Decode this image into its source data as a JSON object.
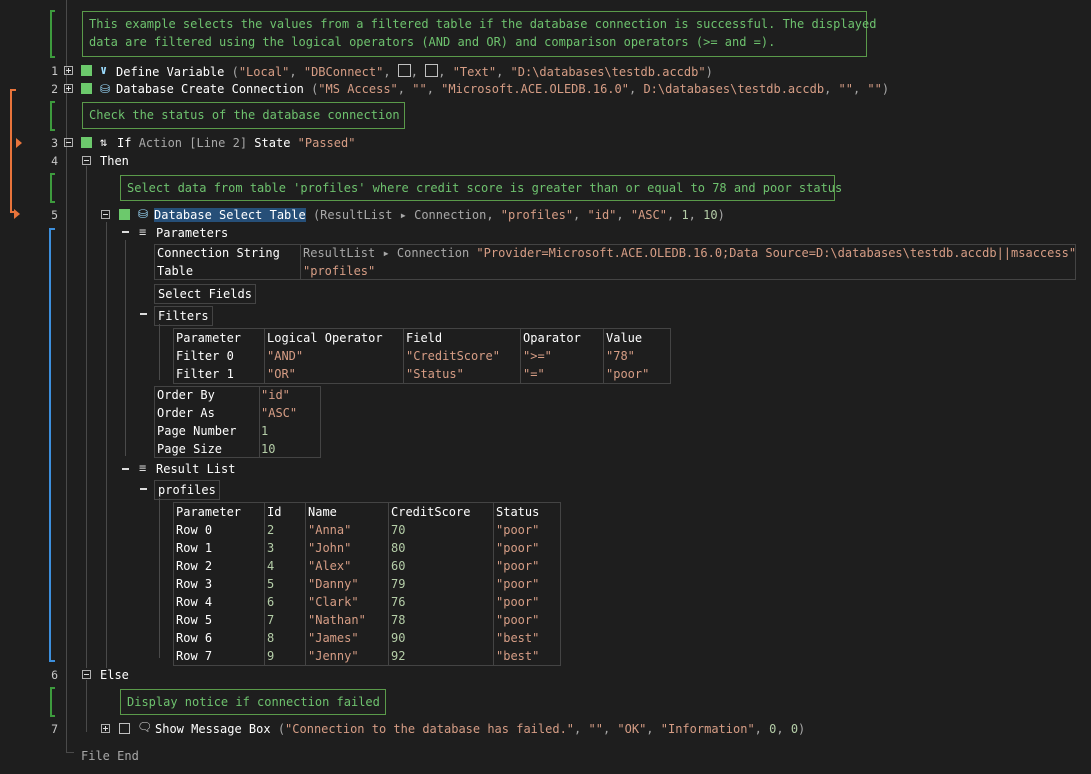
{
  "comments": {
    "c1_line1": "This example selects the values from a filtered table if the database connection is successful. The displayed",
    "c1_line2": "data are filtered using the logical operators (AND and OR) and comparison operators (>= and =).",
    "c2": "Check the status of the database connection",
    "c3": "Select data from table 'profiles' where credit score is greater than or equal to 78 and poor status",
    "c4": "Display notice if connection failed"
  },
  "lines": {
    "l1": {
      "num": "1",
      "cmd": "Define Variable",
      "open": " (",
      "a1": "\"Local\"",
      "a2": "\"DBConnect\"",
      "a3": "\"Text\"",
      "a4": "\"D:\\databases\\testdb.accdb\"",
      "close": ")"
    },
    "l2": {
      "num": "2",
      "cmd": "Database Create Connection",
      "open": " (",
      "a1": "\"MS Access\"",
      "a2": "\"\"",
      "a3": "\"Microsoft.ACE.OLEDB.16.0\"",
      "a4": "D:\\databases\\testdb.accdb",
      "a5": "\"\"",
      "a6": "\"\"",
      "close": ")"
    },
    "l3": {
      "num": "3",
      "cmd": "If",
      "action": "Action [Line 2]",
      "state": "State",
      "val": "\"Passed\""
    },
    "l4": {
      "num": "4",
      "cmd": "Then"
    },
    "l5": {
      "num": "5",
      "cmd": "Database Select Table",
      "open": " (",
      "a1": "ResultList ▸ Connection",
      "a2": "\"profiles\"",
      "a3": "\"id\"",
      "a4": "\"ASC\"",
      "a5": "1",
      "a6": "10",
      "close": ")"
    },
    "l6": {
      "num": "6",
      "cmd": "Else"
    },
    "l7": {
      "num": "7",
      "cmd": "Show Message Box",
      "open": " (",
      "a1": "\"Connection to the database has failed.\"",
      "a2": "\"\"",
      "a3": "\"OK\"",
      "a4": "\"Information\"",
      "a5": "0",
      "a6": "0",
      "close": ")"
    },
    "file_end": "File End"
  },
  "parameters": {
    "label": "Parameters",
    "conn_key": "Connection String",
    "conn_val_prefix": "ResultList ▸ Connection",
    "conn_val": "\"Provider=Microsoft.ACE.OLEDB.16.0;Data Source=D:\\databases\\testdb.accdb||msaccess\"",
    "table_key": "Table",
    "table_val": "\"profiles\"",
    "select_fields": "Select Fields",
    "filters": "Filters",
    "filter_headers": [
      "Parameter",
      "Logical Operator",
      "Field",
      "Oparator",
      "Value"
    ],
    "filter_rows": [
      [
        "Filter 0",
        "\"AND\"",
        "\"CreditScore\"",
        "\">=\"",
        "\"78\""
      ],
      [
        "Filter 1",
        "\"OR\"",
        "\"Status\"",
        "\"=\"",
        "\"poor\""
      ]
    ],
    "order_by_key": "Order By",
    "order_by_val": "\"id\"",
    "order_as_key": "Order As",
    "order_as_val": "\"ASC\"",
    "page_number_key": "Page Number",
    "page_number_val": "1",
    "page_size_key": "Page Size",
    "page_size_val": "10"
  },
  "result": {
    "label": "Result List",
    "profiles": "profiles",
    "headers": [
      "Parameter",
      "Id",
      "Name",
      "CreditScore",
      "Status"
    ],
    "rows": [
      [
        "Row 0",
        "2",
        "\"Anna\"",
        "70",
        "\"poor\""
      ],
      [
        "Row 1",
        "3",
        "\"John\"",
        "80",
        "\"poor\""
      ],
      [
        "Row 2",
        "4",
        "\"Alex\"",
        "60",
        "\"poor\""
      ],
      [
        "Row 3",
        "5",
        "\"Danny\"",
        "79",
        "\"poor\""
      ],
      [
        "Row 4",
        "6",
        "\"Clark\"",
        "76",
        "\"poor\""
      ],
      [
        "Row 5",
        "7",
        "\"Nathan\"",
        "78",
        "\"poor\""
      ],
      [
        "Row 6",
        "8",
        "\"James\"",
        "90",
        "\"best\""
      ],
      [
        "Row 7",
        "9",
        "\"Jenny\"",
        "92",
        "\"best\""
      ]
    ]
  }
}
